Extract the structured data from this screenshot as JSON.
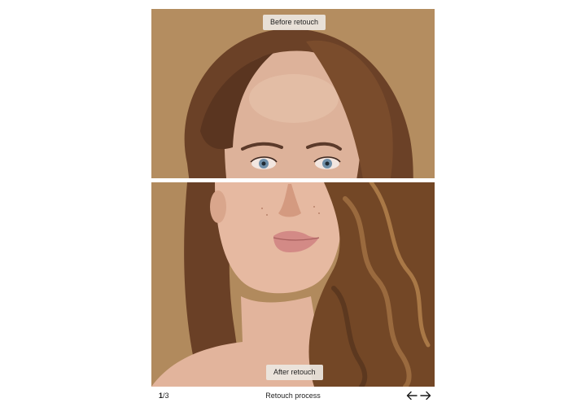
{
  "labels": {
    "before": "Before retouch",
    "after": "After retouch"
  },
  "pager": {
    "current": "1",
    "separator": "/",
    "total": "3"
  },
  "caption": "Retouch process",
  "icons": {
    "prev": "arrow-left-icon",
    "next": "arrow-right-icon"
  },
  "colors": {
    "backdrop": "#b38c60",
    "hair": "#6a4026",
    "skin": "#e4b79f"
  }
}
